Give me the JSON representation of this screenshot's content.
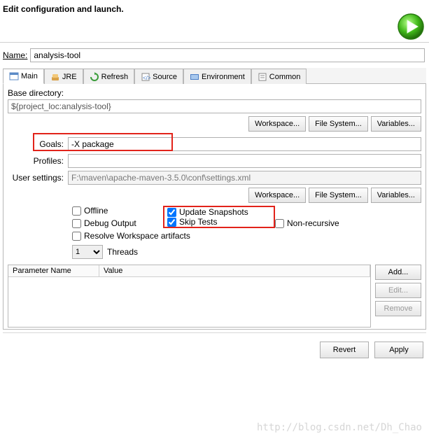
{
  "title": "Edit configuration and launch.",
  "nameLabel": "Name:",
  "nameValue": "analysis-tool",
  "tabs": {
    "main": "Main",
    "jre": "JRE",
    "refresh": "Refresh",
    "source": "Source",
    "environment": "Environment",
    "common": "Common"
  },
  "baseDirLabel": "Base directory:",
  "baseDirValue": "${project_loc:analysis-tool}",
  "btns": {
    "workspace": "Workspace...",
    "filesystem": "File System...",
    "variables": "Variables..."
  },
  "goalsLabel": "Goals:",
  "goalsValue": "-X package",
  "profilesLabel": "Profiles:",
  "profilesValue": "",
  "userSettingsLabel": "User settings:",
  "userSettingsValue": "F:\\maven\\apache-maven-3.5.0\\conf\\settings.xml",
  "checks": {
    "offline": "Offline",
    "updateSnapshots": "Update Snapshots",
    "debugOutput": "Debug Output",
    "skipTests": "Skip Tests",
    "nonRecursive": "Non-recursive",
    "resolveWorkspace": "Resolve Workspace artifacts"
  },
  "threadsLabel": "Threads",
  "threadsValue": "1",
  "paramTable": {
    "col1": "Parameter Name",
    "col2": "Value",
    "add": "Add...",
    "edit": "Edit...",
    "remove": "Remove"
  },
  "footer": {
    "revert": "Revert",
    "apply": "Apply"
  },
  "watermark": "http://blog.csdn.net/Dh_Chao"
}
